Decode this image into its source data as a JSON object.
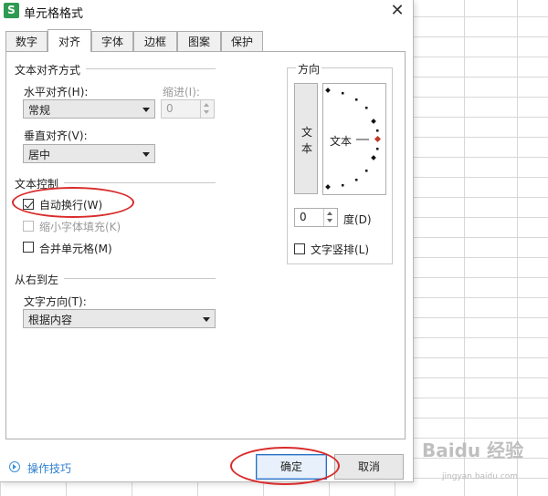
{
  "window": {
    "title": "单元格格式",
    "app_icon": "S",
    "close_glyph": "✕"
  },
  "tabs": [
    {
      "label": "数字",
      "active": false
    },
    {
      "label": "对齐",
      "active": true
    },
    {
      "label": "字体",
      "active": false
    },
    {
      "label": "边框",
      "active": false
    },
    {
      "label": "图案",
      "active": false
    },
    {
      "label": "保护",
      "active": false
    }
  ],
  "alignment": {
    "group_title": "文本对齐方式",
    "horizontal_label": "水平对齐(H):",
    "horizontal_value": "常规",
    "indent_label": "缩进(I):",
    "indent_value": "0",
    "vertical_label": "垂直对齐(V):",
    "vertical_value": "居中"
  },
  "text_control": {
    "group_title": "文本控制",
    "wrap_text_label": "自动换行(W)",
    "wrap_text_checked": true,
    "shrink_to_fit_label": "缩小字体填充(K)",
    "shrink_to_fit_checked": false,
    "merge_cells_label": "合并单元格(M)",
    "merge_cells_checked": false
  },
  "rtl": {
    "group_title": "从右到左",
    "direction_label": "文字方向(T):",
    "direction_value": "根据内容"
  },
  "orientation": {
    "group_title": "方向",
    "vertical_text": "文本",
    "dial_text": "文本",
    "degrees_value": "0",
    "degrees_label": "度(D)",
    "vertical_stack_label": "文字竖排(L)",
    "vertical_stack_checked": false
  },
  "footer": {
    "tips_label": "操作技巧",
    "ok_label": "确定",
    "cancel_label": "取消"
  },
  "watermark": {
    "text": "Baidu 经验",
    "sub": "jingyan.baidu.com"
  },
  "colors": {
    "annotation_red": "#d92b2b",
    "link_blue": "#2d7fd0",
    "primary_border": "#2b6fc2",
    "app_icon_green": "#2f9a51",
    "dial_pointer": "#c0392b"
  }
}
